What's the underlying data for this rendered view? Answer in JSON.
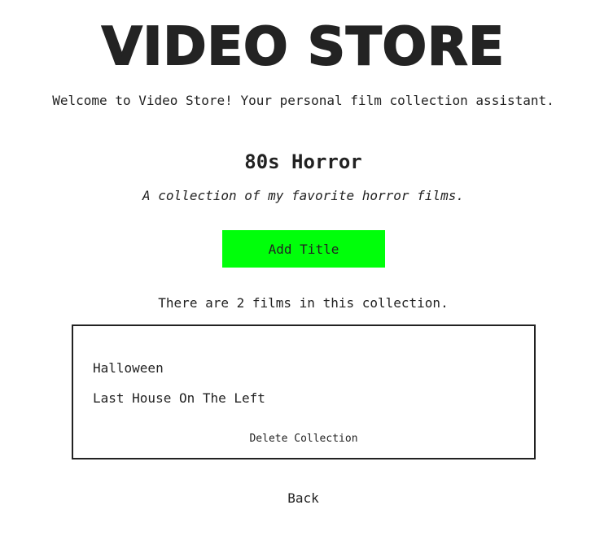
{
  "header": {
    "logo_text": "VIDEO STORE",
    "tagline": "Welcome to Video Store! Your personal film collection assistant."
  },
  "collection": {
    "title": "80s Horror",
    "description": "A collection of my favorite horror films.",
    "add_button_label": "Add Title",
    "count_text": "There are 2 films in this collection.",
    "films": [
      "Halloween",
      "Last House On The Left"
    ],
    "delete_label": "Delete Collection"
  },
  "nav": {
    "back_label": "Back"
  },
  "colors": {
    "accent_green": "#00ff0a",
    "text": "#222222",
    "background": "#ffffff"
  }
}
